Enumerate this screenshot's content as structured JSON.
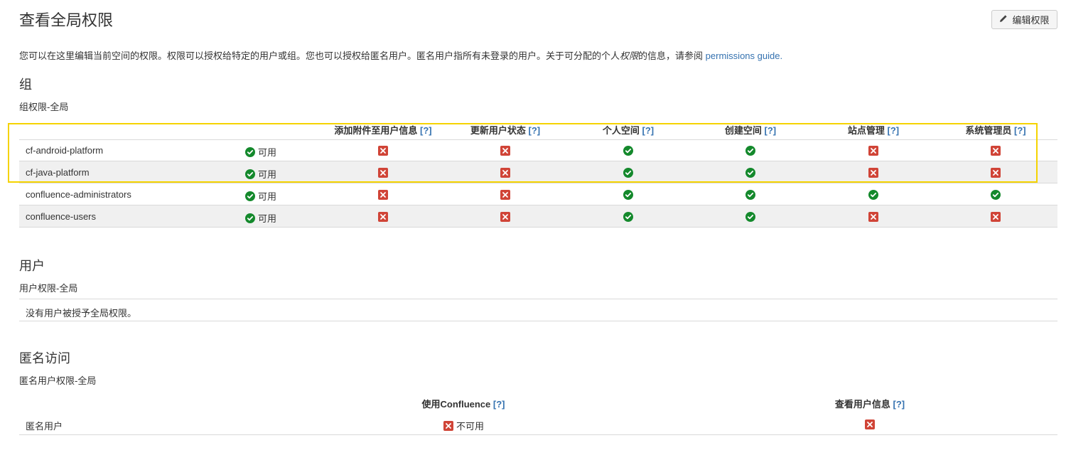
{
  "page": {
    "title": "查看全局权限",
    "edit_button_label": "编辑权限",
    "intro_text_1": "您可以在这里编辑当前空间的权限。权限可以授权给特定的用户或组。您也可以授权给匿名用户。匿名用户指所有未登录的用户。关于可分配的个人",
    "intro_emphasis": "权限",
    "intro_text_2": "的信息，请参阅",
    "intro_link": "permissions guide."
  },
  "help_label": "[?]",
  "groups": {
    "section_title": "组",
    "subtitle": "组权限-全局",
    "available_label": "可用",
    "columns": [
      "添加附件至用户信息",
      "更新用户状态",
      "个人空间",
      "创建空间",
      "站点管理",
      "系统管理员"
    ],
    "rows": [
      {
        "name": "cf-android-platform",
        "perms": [
          false,
          false,
          true,
          true,
          false,
          false
        ]
      },
      {
        "name": "cf-java-platform",
        "perms": [
          false,
          false,
          true,
          true,
          false,
          false
        ]
      },
      {
        "name": "confluence-administrators",
        "perms": [
          false,
          false,
          true,
          true,
          true,
          true
        ]
      },
      {
        "name": "confluence-users",
        "perms": [
          false,
          false,
          true,
          true,
          false,
          false
        ]
      }
    ]
  },
  "users": {
    "section_title": "用户",
    "subtitle": "用户权限-全局",
    "empty_text": "没有用户被授予全局权限。"
  },
  "anonymous": {
    "section_title": "匿名访问",
    "subtitle": "匿名用户权限-全局",
    "columns": [
      "使用Confluence",
      "查看用户信息"
    ],
    "row_name": "匿名用户",
    "use_confluence_status": "不可用"
  },
  "colors": {
    "granted": "#14892c",
    "denied": "#d04437",
    "link": "#3572b0",
    "highlight": "#f5d300"
  }
}
